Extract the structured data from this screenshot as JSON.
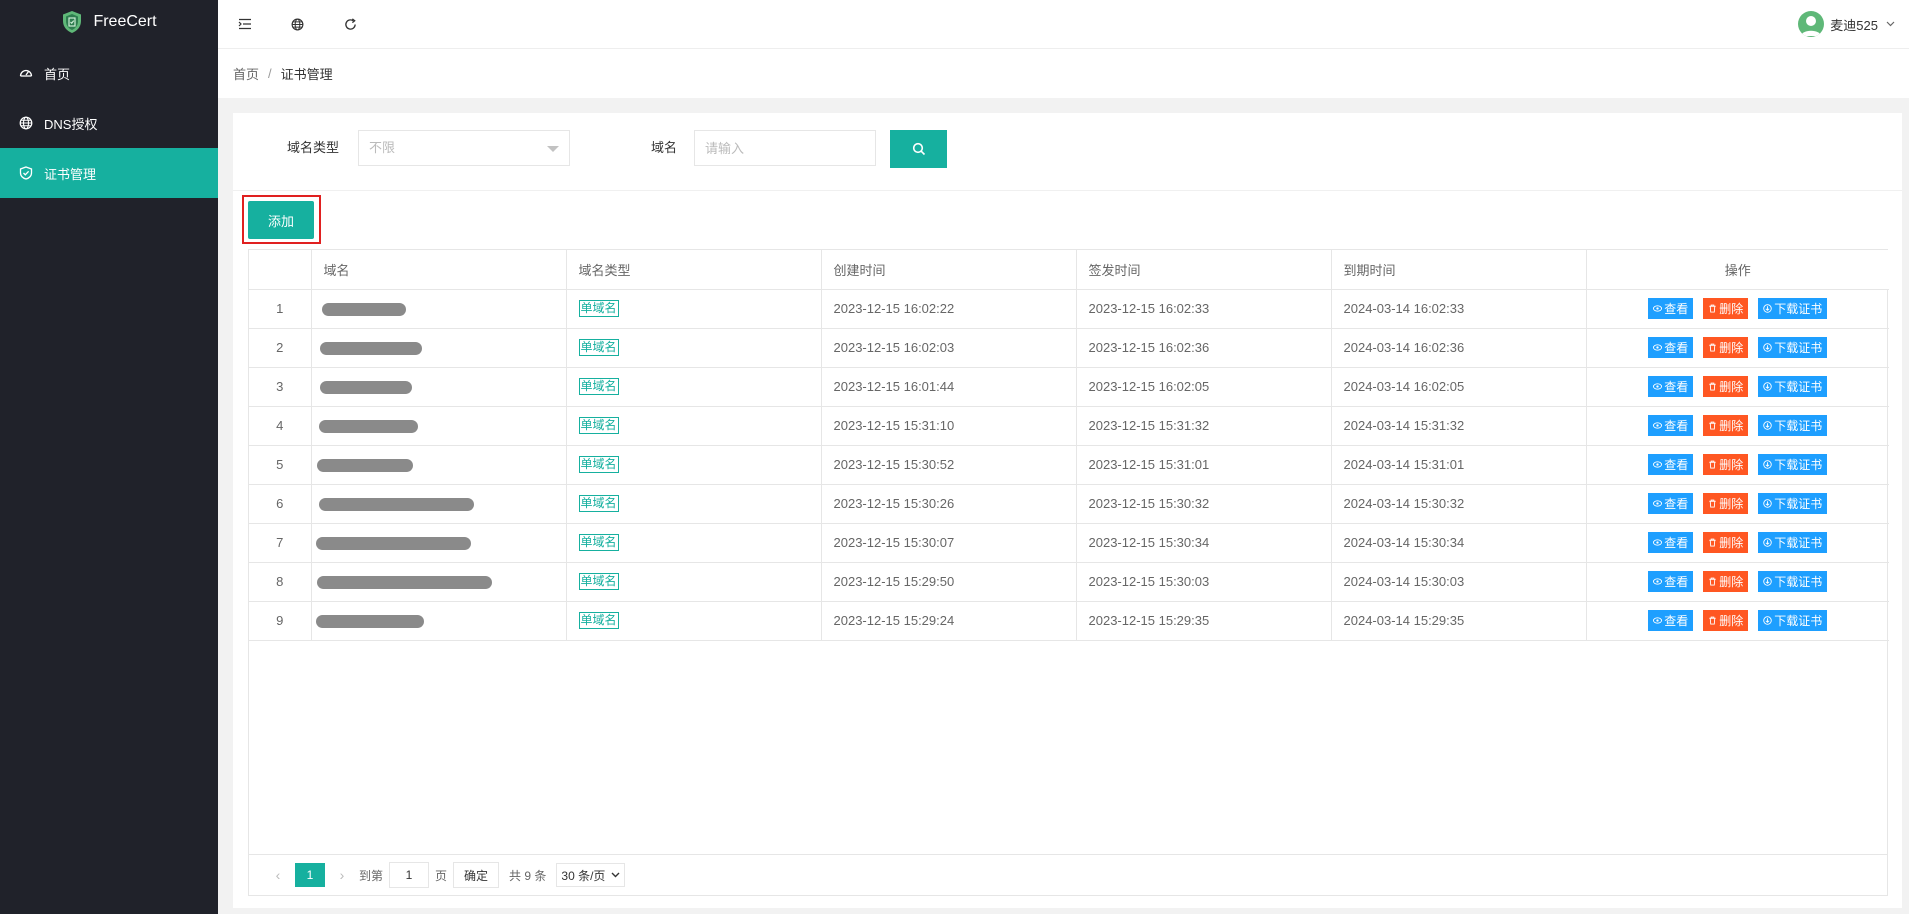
{
  "app": {
    "name": "FreeCert"
  },
  "sidebar": {
    "items": [
      {
        "label": "首页",
        "icon": "dashboard-icon",
        "active": false
      },
      {
        "label": "DNS授权",
        "icon": "globe-icon",
        "active": false
      },
      {
        "label": "证书管理",
        "icon": "shield-check-icon",
        "active": true
      }
    ]
  },
  "header": {
    "icons": [
      "menu-fold-icon",
      "globe-icon",
      "refresh-icon"
    ],
    "user": {
      "name": "麦迪525"
    }
  },
  "breadcrumb": {
    "home": "首页",
    "sep": "/",
    "current": "证书管理"
  },
  "filter": {
    "type_label": "域名类型",
    "type_value": "不限",
    "domain_label": "域名",
    "domain_placeholder": "请输入"
  },
  "toolbar": {
    "add_label": "添加"
  },
  "table": {
    "headers": {
      "domain": "域名",
      "type": "域名类型",
      "created": "创建时间",
      "issued": "签发时间",
      "expires": "到期时间",
      "ops": "操作"
    },
    "actions": {
      "view": "查看",
      "delete": "删除",
      "download": "下载证书"
    },
    "rows": [
      {
        "idx": "1",
        "type": "单域名",
        "created": "2023-12-15 16:02:22",
        "issued": "2023-12-15 16:02:33",
        "expires": "2024-03-14 16:02:33"
      },
      {
        "idx": "2",
        "type": "单域名",
        "created": "2023-12-15 16:02:03",
        "issued": "2023-12-15 16:02:36",
        "expires": "2024-03-14 16:02:36"
      },
      {
        "idx": "3",
        "type": "单域名",
        "created": "2023-12-15 16:01:44",
        "issued": "2023-12-15 16:02:05",
        "expires": "2024-03-14 16:02:05"
      },
      {
        "idx": "4",
        "type": "单域名",
        "created": "2023-12-15 15:31:10",
        "issued": "2023-12-15 15:31:32",
        "expires": "2024-03-14 15:31:32"
      },
      {
        "idx": "5",
        "type": "单域名",
        "created": "2023-12-15 15:30:52",
        "issued": "2023-12-15 15:31:01",
        "expires": "2024-03-14 15:31:01"
      },
      {
        "idx": "6",
        "type": "单域名",
        "created": "2023-12-15 15:30:26",
        "issued": "2023-12-15 15:30:32",
        "expires": "2024-03-14 15:30:32"
      },
      {
        "idx": "7",
        "type": "单域名",
        "created": "2023-12-15 15:30:07",
        "issued": "2023-12-15 15:30:34",
        "expires": "2024-03-14 15:30:34"
      },
      {
        "idx": "8",
        "type": "单域名",
        "created": "2023-12-15 15:29:50",
        "issued": "2023-12-15 15:30:03",
        "expires": "2024-03-14 15:30:03"
      },
      {
        "idx": "9",
        "type": "单域名",
        "created": "2023-12-15 15:29:24",
        "issued": "2023-12-15 15:29:35",
        "expires": "2024-03-14 15:29:35"
      }
    ]
  },
  "pager": {
    "current": "1",
    "goto_label": "到第",
    "goto_value": "1",
    "page_unit": "页",
    "confirm": "确定",
    "total": "共 9 条",
    "page_size": "30 条/页"
  },
  "colors": {
    "accent": "#16b09f",
    "sidebar_bg": "#20222a",
    "view_btn": "#1e9fff",
    "delete_btn": "#ff5722"
  }
}
